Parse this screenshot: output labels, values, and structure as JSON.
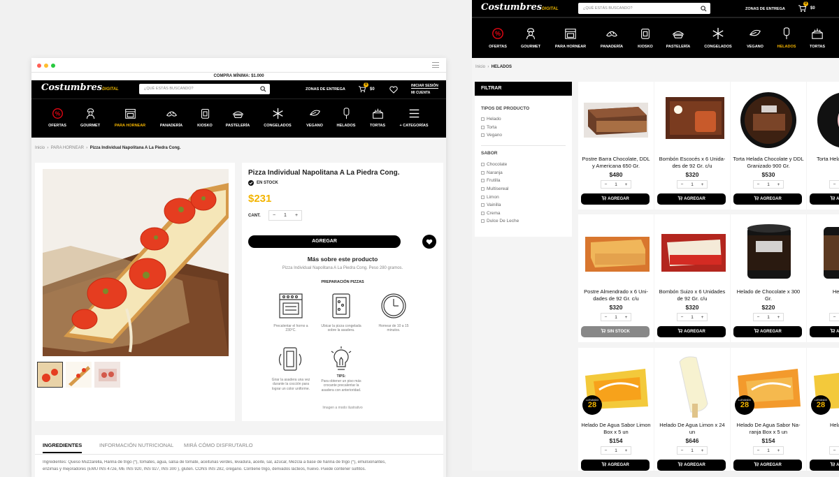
{
  "left": {
    "promo": "COMPRA MÍNIMA: $1.000",
    "logo": "Costumbres",
    "logo_sub": "DIGITAL",
    "search_placeholder": "¿QUÉ ESTÁS BUSCANDO?",
    "zones": "ZONAS DE ENTREGA",
    "cart_count": "0",
    "cart_total": "$0",
    "login_1": "INICIAR SESIÓN",
    "login_2": "MI CUENTA",
    "categories": [
      "OFERTAS",
      "GOURMET",
      "PARA HORNEAR",
      "PANADERÍA",
      "KIOSKO",
      "PASTELERÍA",
      "CONGELADOS",
      "VEGANO",
      "HELADOS",
      "TORTAS",
      "+ CATEGORÍAS"
    ],
    "active_category": "PARA HORNEAR",
    "breadcrumb": [
      "Inicio",
      "PARA HORNEAR",
      "Pizza Individual Napolitana A La Piedra Cong."
    ],
    "product": {
      "title": "Pizza Individual Napolitana A La Piedra Cong.",
      "stock": "EN STOCK",
      "price": "$231",
      "qty_label": "CANT.",
      "qty_minus": "−",
      "qty": "1",
      "qty_plus": "+",
      "add": "AGREGAR",
      "more_title": "Más sobre este producto",
      "more_desc": "Pizza Individual Napolitana A La Piedra Cong. Peso 280 gramos.",
      "prep_title": "PREPARACIÓN PIZZAS",
      "steps": [
        "Precalentar el horno a 230°C.",
        "Ubicar la pizza congelada sobre la asadera.",
        "Hornear de 10 a 15 minutos.",
        "Girar la asadera una vez durante la cocción para lograr un color uniforme.",
        "Para obtener un piso más crocante precalentar la asadera con anterioridad."
      ],
      "tips_label": "TIPS:",
      "illustrative": "Imagen a modo ilustrativo"
    },
    "tabs": [
      "INGREDIENTES",
      "INFORMACIÓN NUTRICIONAL",
      "MIRÁ CÓMO DISFRUTARLO"
    ],
    "ingredients_text": "Ingredientes: Queso Muzzarella, Harina de trigo (*), tomates, agua, salsa de tomate, aceitunas verdes, levadura, aceite, sal, azúcar, Mezcla a base de harina de trigo (*), emulsionantes,",
    "ingredients_text2": "enzimas y mejoradores (EMU INS 472e, ME INS 920, INS 927, INS 300 ), gluten. CONS INS 282, orégano. Contiene trigo, derivados lácteos, huevo. Puede contener sulfitos."
  },
  "right": {
    "logo": "Costumbres",
    "logo_sub": "DIGITAL",
    "search_placeholder": "¿QUÉ ESTÁS BUSCANDO?",
    "zones": "ZONAS DE ENTREGA",
    "cart_count": "0",
    "cart_total": "$0",
    "categories": [
      "OFERTAS",
      "GOURMET",
      "PARA HORNEAR",
      "PANADERÍA",
      "KIOSKO",
      "PASTELERÍA",
      "CONGELADOS",
      "VEGANO",
      "HELADOS",
      "TORTAS"
    ],
    "active_category": "HELADOS",
    "breadcrumb": [
      "Inicio",
      "HELADOS"
    ],
    "filter_title": "FILTRAR",
    "filter_groups": [
      {
        "title": "TIPOS DE PRODUCTO",
        "options": [
          "Helado",
          "Torta",
          "Vegano"
        ]
      },
      {
        "title": "SABOR",
        "options": [
          "Chocolate",
          "Naranja",
          "Frutilla",
          "Multisereal",
          "Limon",
          "Vainilla",
          "Crema",
          "Dulce De Leche"
        ]
      }
    ],
    "products": [
      {
        "name": "Postre Barra Chocolate, DDL y Americana 650 Gr.",
        "price": "$480",
        "qty": "1",
        "btn": "AGREGAR",
        "stock": true
      },
      {
        "name": "Bombón Escocés x 6 Unida-des de 92 Gr. c/u",
        "price": "$320",
        "qty": "1",
        "btn": "AGREGAR",
        "stock": true
      },
      {
        "name": "Torta Helada Chocolate y DDL Granizado 900 Gr.",
        "price": "$530",
        "qty": "1",
        "btn": "AGREGAR",
        "stock": true
      },
      {
        "name": "Torta Helada Americana",
        "price": "",
        "qty": "1",
        "btn": "AGREGAR",
        "stock": true
      },
      {
        "name": "Postre Almendrado x 6 Uni-dades de 92 Gr. c/u",
        "price": "$320",
        "qty": "1",
        "btn": "SIN STOCK",
        "stock": false
      },
      {
        "name": "Bombón Suizo x 6 Unidades de 92 Gr. c/u",
        "price": "$320",
        "qty": "1",
        "btn": "AGREGAR",
        "stock": true
      },
      {
        "name": "Helado de Chocolate x 300 Gr.",
        "price": "$220",
        "qty": "1",
        "btn": "AGREGAR",
        "stock": true
      },
      {
        "name": "Helado de",
        "price": "",
        "qty": "1",
        "btn": "AGREGAR",
        "stock": true
      },
      {
        "name": "Helado De Agua Sabor Limon Box x 5 un",
        "price": "$154",
        "qty": "1",
        "btn": "AGREGAR",
        "stock": true
      },
      {
        "name": "Helado De Agua Limon x 24 un",
        "price": "$646",
        "qty": "1",
        "btn": "AGREGAR",
        "stock": true
      },
      {
        "name": "Helado De Agua Sabor Na-ranja Box x 5 un",
        "price": "$154",
        "qty": "1",
        "btn": "AGREGAR",
        "stock": true
      },
      {
        "name": "Helado De A",
        "price": "",
        "qty": "1",
        "btn": "AGREGAR",
        "stock": true
      }
    ],
    "badge_label": "LLEVANDO",
    "badge_value": "28",
    "qty_minus": "−",
    "qty_plus": "+"
  },
  "colors": {
    "accent": "#f3b400",
    "black": "#000000",
    "red": "#e30613"
  }
}
